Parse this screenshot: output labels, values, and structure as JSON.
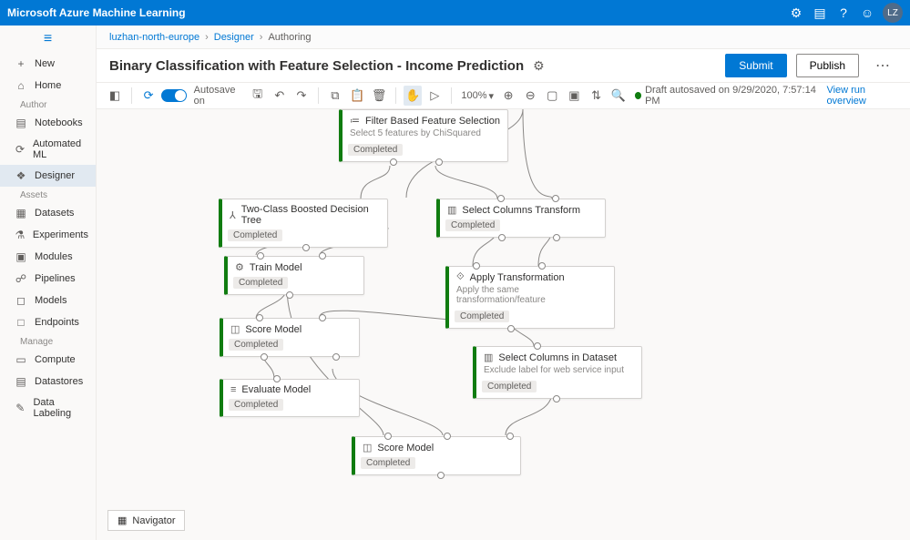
{
  "header": {
    "product": "Microsoft Azure Machine Learning"
  },
  "sidebar": {
    "new": "New",
    "home": "Home",
    "sections": {
      "author": "Author",
      "assets": "Assets",
      "manage": "Manage"
    },
    "items": {
      "notebooks": "Notebooks",
      "automl": "Automated ML",
      "designer": "Designer",
      "datasets": "Datasets",
      "experiments": "Experiments",
      "modules": "Modules",
      "pipelines": "Pipelines",
      "models": "Models",
      "endpoints": "Endpoints",
      "compute": "Compute",
      "datastores": "Datastores",
      "datalabeling": "Data Labeling"
    }
  },
  "breadcrumb": {
    "workspace": "luzhan-north-europe",
    "designer": "Designer",
    "current": "Authoring"
  },
  "page": {
    "title": "Binary Classification with Feature Selection - Income Prediction",
    "submit": "Submit",
    "publish": "Publish"
  },
  "toolbar": {
    "autosave": "Autosave on",
    "zoom": "100%",
    "draft_status": "Draft autosaved on 9/29/2020, 7:57:14 PM",
    "view_link": "View run overview"
  },
  "navigator": "Navigator",
  "status_completed": "Completed",
  "nodes": {
    "fbfs": {
      "title": "Filter Based Feature Selection",
      "desc": "Select 5 features by ChiSquared"
    },
    "boost": {
      "title": "Two-Class Boosted Decision Tree"
    },
    "sct": {
      "title": "Select Columns Transform"
    },
    "train": {
      "title": "Train Model"
    },
    "apply": {
      "title": "Apply Transformation",
      "desc": "Apply the same transformation/feature"
    },
    "score1": {
      "title": "Score Model"
    },
    "scd": {
      "title": "Select Columns in Dataset",
      "desc": "Exclude label for web service input"
    },
    "eval": {
      "title": "Evaluate Model"
    },
    "score2": {
      "title": "Score Model"
    }
  }
}
